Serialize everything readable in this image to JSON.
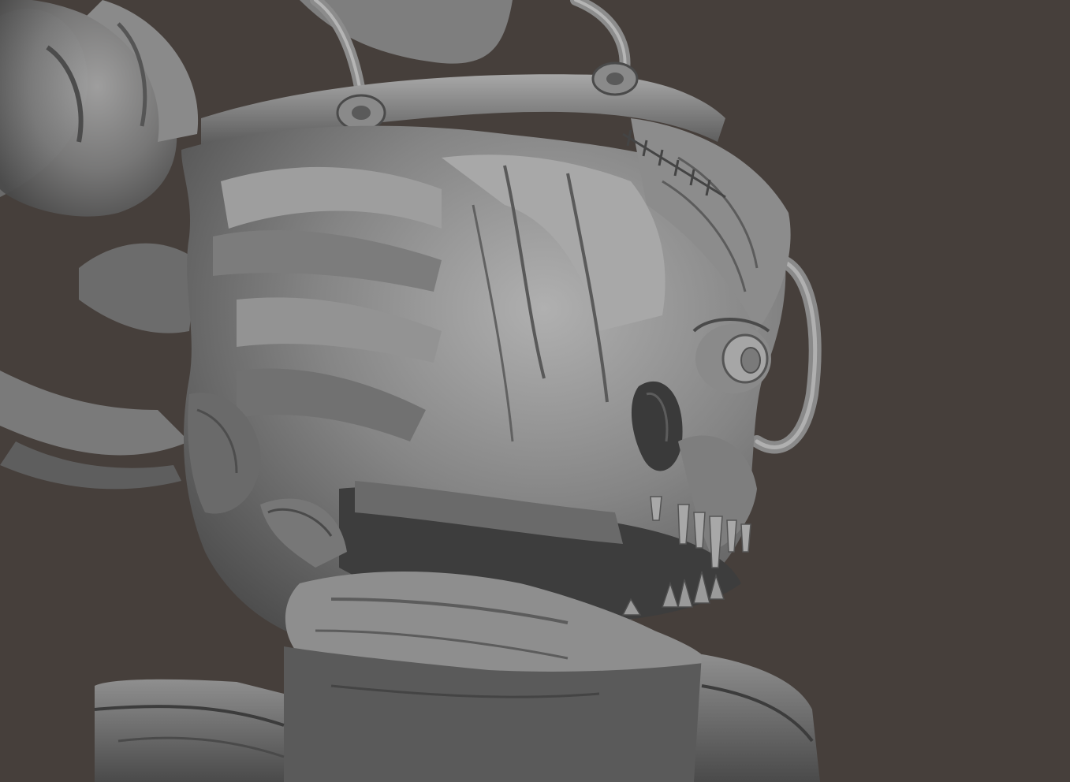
{
  "scene": {
    "subject_icon": "clay-creature-head-sculpt",
    "colors": {
      "background": "#463f3b",
      "clay_base": "#6e6e6e",
      "clay_light": "#9a9a9a",
      "clay_highlight": "#b4b4b4",
      "clay_shadow": "#3f3f3f",
      "clay_deep": "#2e2e2e"
    }
  }
}
